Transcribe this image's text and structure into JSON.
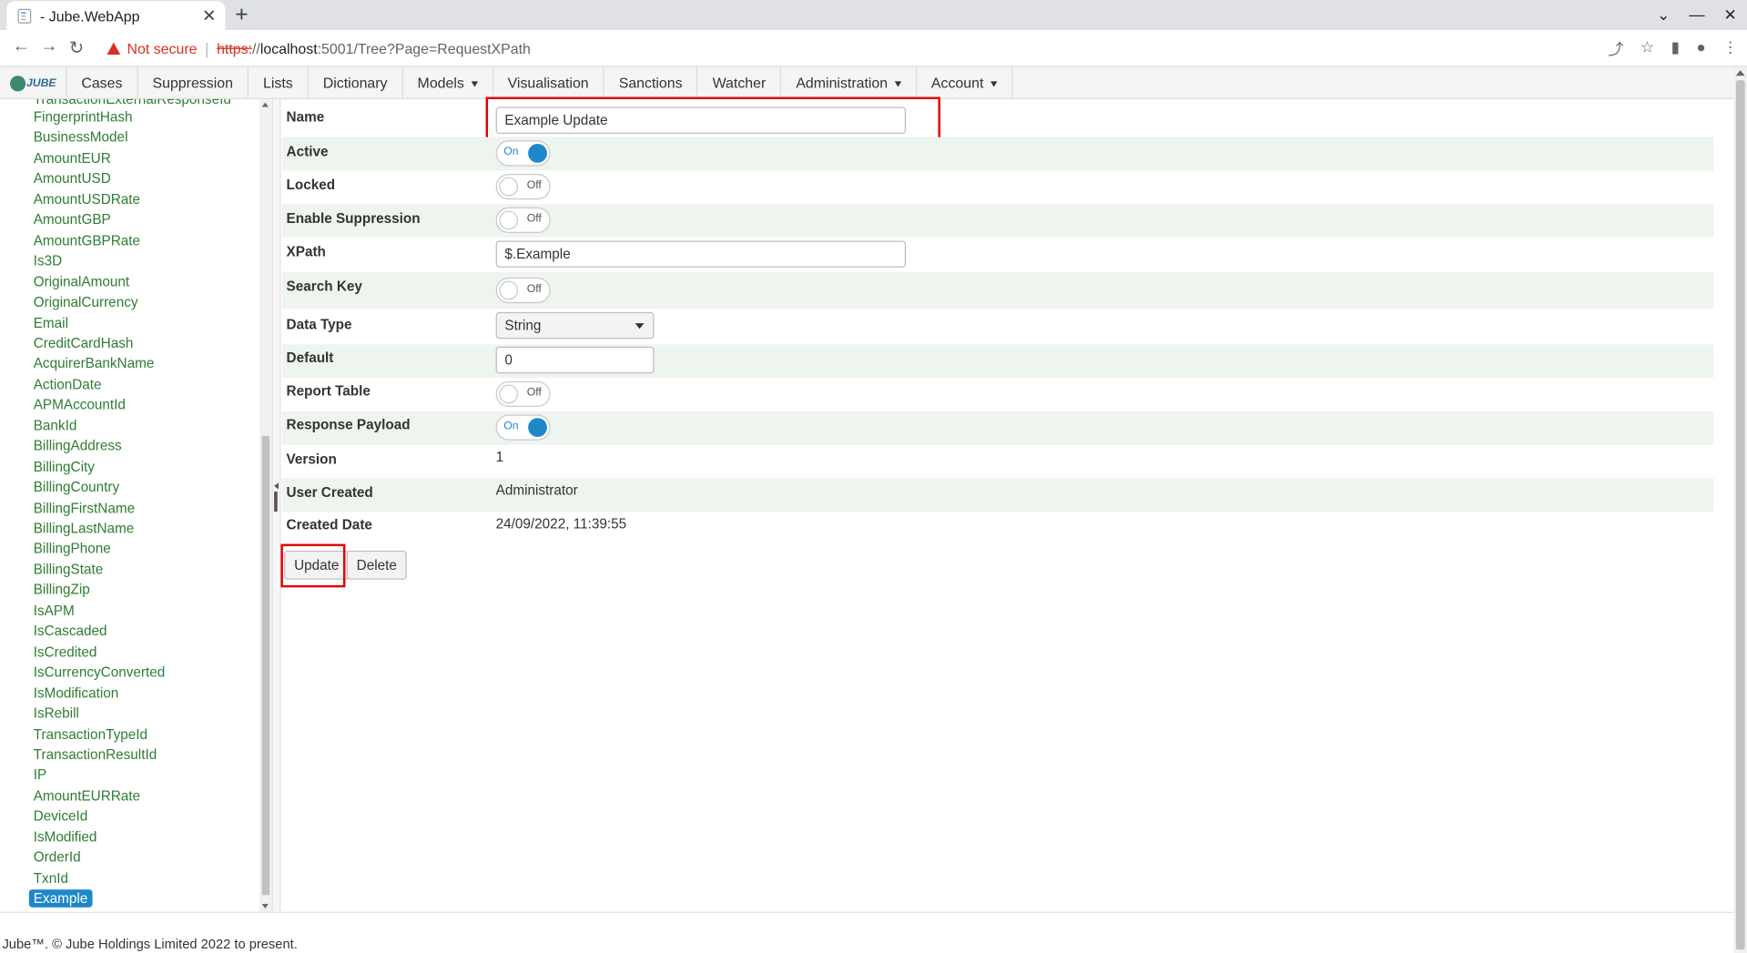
{
  "browser": {
    "tab_title": "- Jube.WebApp",
    "new_tab": "+",
    "not_secure": "Not secure",
    "url_scheme": "https:",
    "url_slashes": "//",
    "url_host": "localhost",
    "url_path": ":5001/Tree?Page=RequestXPath"
  },
  "nav": {
    "logo": "JUBE",
    "items": [
      "Cases",
      "Suppression",
      "Lists",
      "Dictionary",
      "Models",
      "Visualisation",
      "Sanctions",
      "Watcher",
      "Administration",
      "Account"
    ]
  },
  "tree": {
    "cutoff_item": "TransactionExternalResponseId",
    "items": [
      "FingerprintHash",
      "BusinessModel",
      "AmountEUR",
      "AmountUSD",
      "AmountUSDRate",
      "AmountGBP",
      "AmountGBPRate",
      "Is3D",
      "OriginalAmount",
      "OriginalCurrency",
      "Email",
      "CreditCardHash",
      "AcquirerBankName",
      "ActionDate",
      "APMAccountId",
      "BankId",
      "BillingAddress",
      "BillingCity",
      "BillingCountry",
      "BillingFirstName",
      "BillingLastName",
      "BillingPhone",
      "BillingState",
      "BillingZip",
      "IsAPM",
      "IsCascaded",
      "IsCredited",
      "IsCurrencyConverted",
      "IsModification",
      "IsRebill",
      "TransactionTypeId",
      "TransactionResultId",
      "IP",
      "AmountEURRate",
      "DeviceId",
      "IsModified",
      "OrderId",
      "TxnId"
    ],
    "selected": "Example"
  },
  "form": {
    "name_label": "Name",
    "name_value": "Example Update",
    "active_label": "Active",
    "active_state": "On",
    "locked_label": "Locked",
    "locked_state": "Off",
    "suppression_label": "Enable Suppression",
    "suppression_state": "Off",
    "xpath_label": "XPath",
    "xpath_value": "$.Example",
    "searchkey_label": "Search Key",
    "searchkey_state": "Off",
    "datatype_label": "Data Type",
    "datatype_value": "String",
    "default_label": "Default",
    "default_value": "0",
    "reporttable_label": "Report Table",
    "reporttable_state": "Off",
    "responsepayload_label": "Response Payload",
    "responsepayload_state": "On",
    "version_label": "Version",
    "version_value": "1",
    "usercreated_label": "User Created",
    "usercreated_value": "Administrator",
    "createddate_label": "Created Date",
    "createddate_value": "24/09/2022, 11:39:55",
    "update_button": "Update",
    "delete_button": "Delete"
  },
  "footer": "Jube™. © Jube Holdings Limited 2022 to present.",
  "colors": {
    "accent": "#1e88c8",
    "tree_link": "#2e7d32",
    "highlight": "#e00000"
  }
}
